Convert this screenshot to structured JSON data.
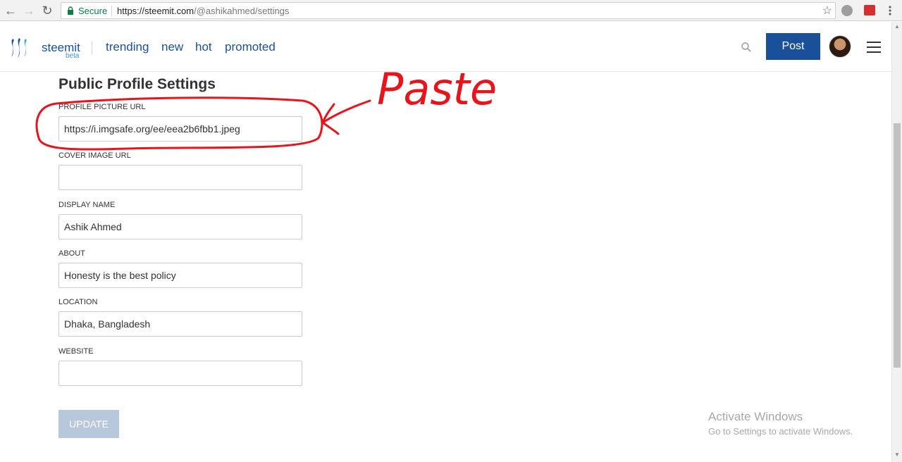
{
  "browser": {
    "secure_label": "Secure",
    "url_host": "https://steemit.com",
    "url_path": "/@ashikahmed/settings",
    "back_glyph": "←",
    "forward_glyph": "→",
    "reload_glyph": "↻",
    "star_glyph": "☆",
    "icons": [
      "back-arrow-icon",
      "forward-arrow-icon",
      "reload-icon",
      "lock-icon",
      "star-icon",
      "extension-icon",
      "chrome-menu-icon"
    ]
  },
  "header": {
    "brand": "steemit",
    "beta": "beta",
    "nav": [
      {
        "label": "trending"
      },
      {
        "label": "new"
      },
      {
        "label": "hot"
      },
      {
        "label": "promoted"
      }
    ],
    "post_label": "Post",
    "accent_color": "#1a5099"
  },
  "main": {
    "title": "Public Profile Settings",
    "fields": [
      {
        "label": "PROFILE PICTURE URL",
        "value": "https://i.imgsafe.org/ee/eea2b6fbb1.jpeg"
      },
      {
        "label": "COVER IMAGE URL",
        "value": ""
      },
      {
        "label": "DISPLAY NAME",
        "value": "Ashik Ahmed"
      },
      {
        "label": "ABOUT",
        "value": "Honesty is the best policy"
      },
      {
        "label": "LOCATION",
        "value": "Dhaka, Bangladesh"
      },
      {
        "label": "WEBSITE",
        "value": ""
      }
    ],
    "update_label": "UPDATE"
  },
  "annotation": {
    "text": "Paste",
    "color": "#e8141c"
  },
  "watermark": {
    "title": "Activate Windows",
    "subtitle": "Go to Settings to activate Windows."
  }
}
